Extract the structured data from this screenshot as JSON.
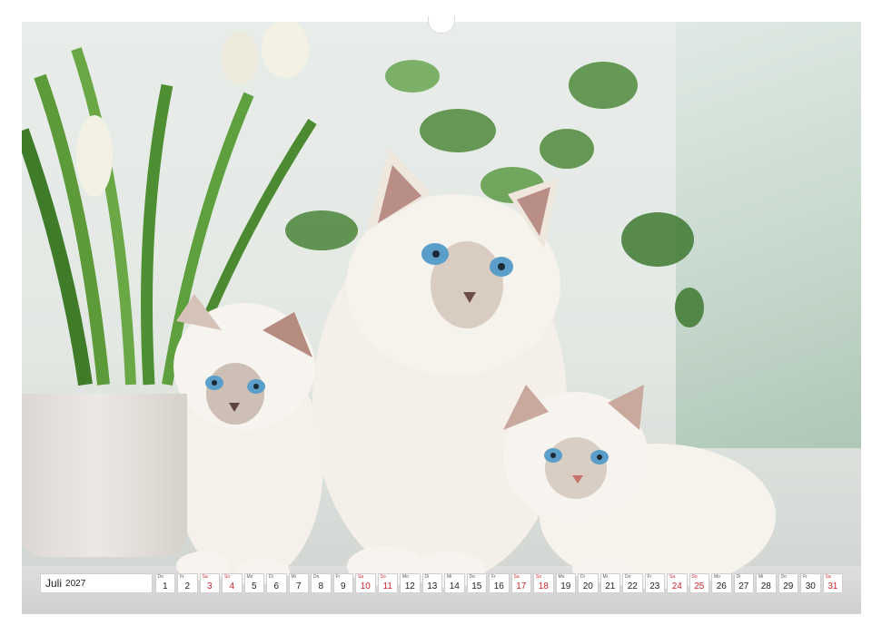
{
  "calendar": {
    "month": "Juli",
    "year": "2027",
    "days": [
      {
        "dow": "Do",
        "num": "1",
        "weekend": false
      },
      {
        "dow": "Fr",
        "num": "2",
        "weekend": false
      },
      {
        "dow": "Sa",
        "num": "3",
        "weekend": true
      },
      {
        "dow": "So",
        "num": "4",
        "weekend": true
      },
      {
        "dow": "Mo",
        "num": "5",
        "weekend": false
      },
      {
        "dow": "Di",
        "num": "6",
        "weekend": false
      },
      {
        "dow": "Mi",
        "num": "7",
        "weekend": false
      },
      {
        "dow": "Do",
        "num": "8",
        "weekend": false
      },
      {
        "dow": "Fr",
        "num": "9",
        "weekend": false
      },
      {
        "dow": "Sa",
        "num": "10",
        "weekend": true
      },
      {
        "dow": "So",
        "num": "11",
        "weekend": true
      },
      {
        "dow": "Mo",
        "num": "12",
        "weekend": false
      },
      {
        "dow": "Di",
        "num": "13",
        "weekend": false
      },
      {
        "dow": "Mi",
        "num": "14",
        "weekend": false
      },
      {
        "dow": "Do",
        "num": "15",
        "weekend": false
      },
      {
        "dow": "Fr",
        "num": "16",
        "weekend": false
      },
      {
        "dow": "Sa",
        "num": "17",
        "weekend": true
      },
      {
        "dow": "So",
        "num": "18",
        "weekend": true
      },
      {
        "dow": "Mo",
        "num": "19",
        "weekend": false
      },
      {
        "dow": "Di",
        "num": "20",
        "weekend": false
      },
      {
        "dow": "Mi",
        "num": "21",
        "weekend": false
      },
      {
        "dow": "Do",
        "num": "22",
        "weekend": false
      },
      {
        "dow": "Fr",
        "num": "23",
        "weekend": false
      },
      {
        "dow": "Sa",
        "num": "24",
        "weekend": true
      },
      {
        "dow": "So",
        "num": "25",
        "weekend": true
      },
      {
        "dow": "Mo",
        "num": "26",
        "weekend": false
      },
      {
        "dow": "Di",
        "num": "27",
        "weekend": false
      },
      {
        "dow": "Mi",
        "num": "28",
        "weekend": false
      },
      {
        "dow": "Do",
        "num": "29",
        "weekend": false
      },
      {
        "dow": "Fr",
        "num": "30",
        "weekend": false
      },
      {
        "dow": "Sa",
        "num": "31",
        "weekend": true
      }
    ]
  },
  "colors": {
    "weekend": "#d0262c",
    "fur": "#f4efe8",
    "eyes": "#5b9ec9",
    "leaves": "#4f8a3c"
  },
  "photo": {
    "subject_icon": "cat-family-photo"
  }
}
